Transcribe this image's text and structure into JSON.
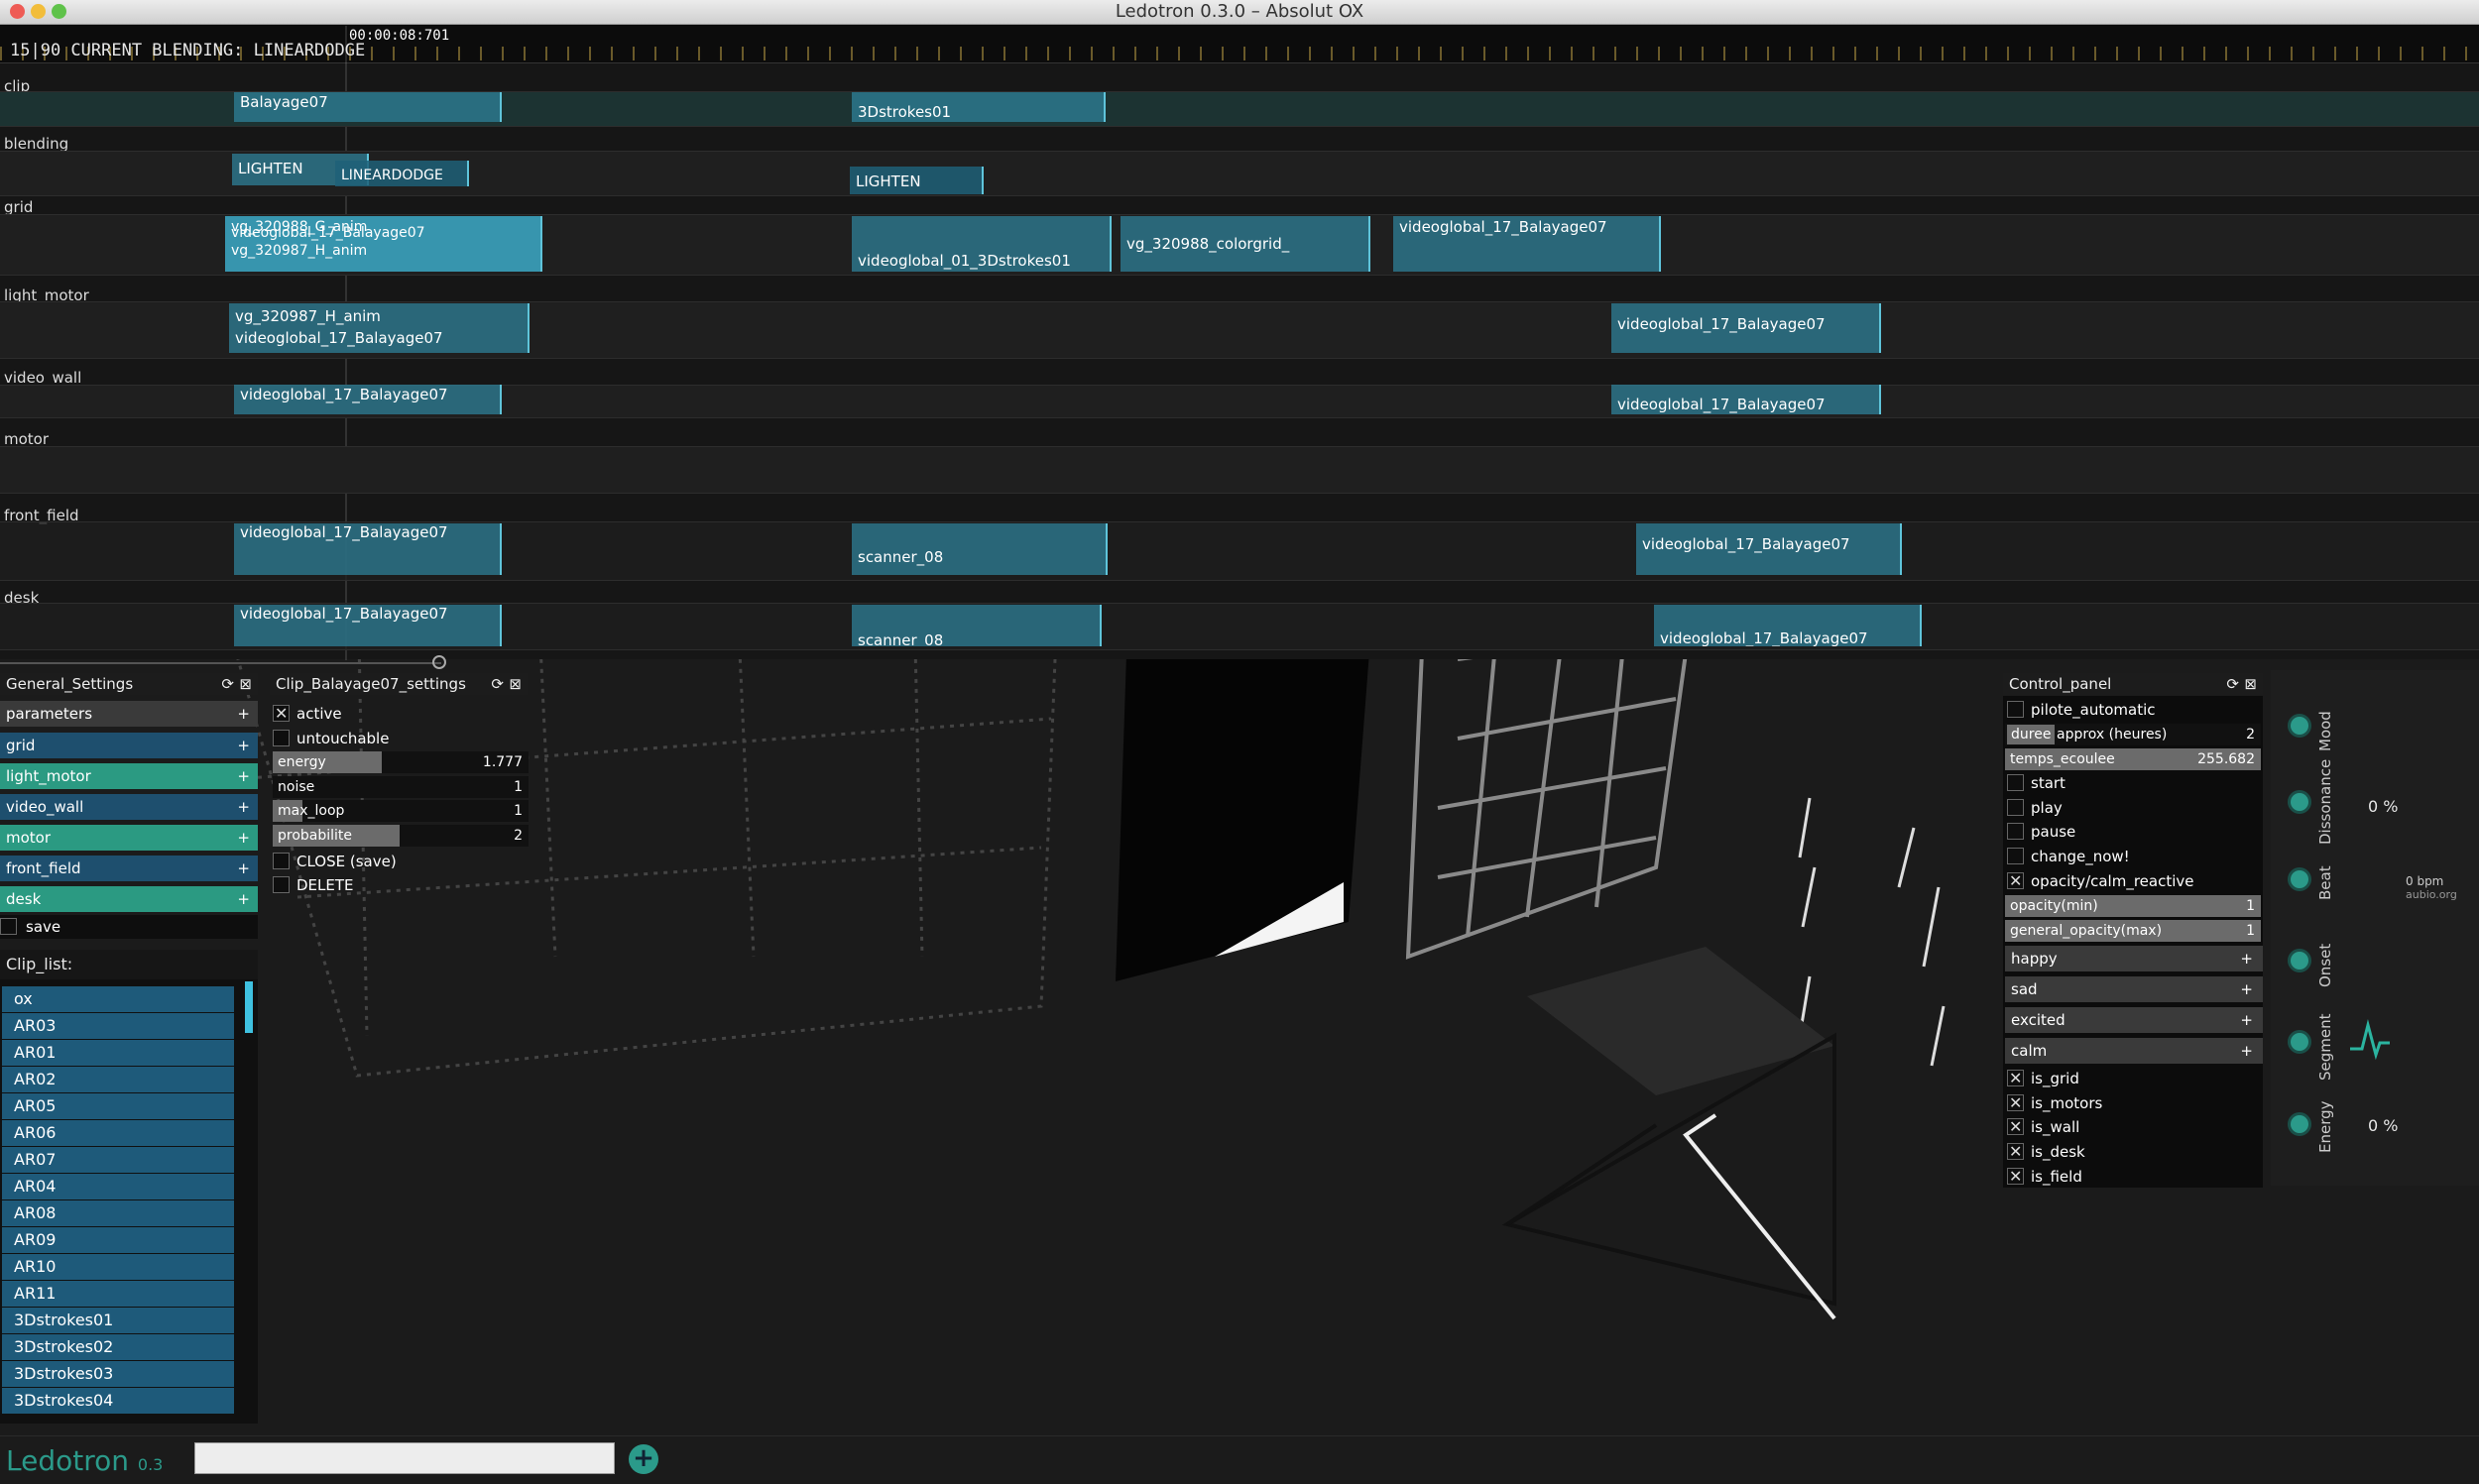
{
  "window": {
    "title": "Ledotron 0.3.0 – Absolut OX"
  },
  "timeline": {
    "status": "15|90 CURRENT BLENDING: LINEARDODGE",
    "time": "00:00:08:701",
    "tracks": [
      {
        "name": "clip",
        "clips": [
          {
            "label": "Balayage07"
          },
          {
            "label": "3Dstrokes01"
          }
        ]
      },
      {
        "name": "blending",
        "clips": [
          {
            "label": "LIGHTEN"
          },
          {
            "label": "LINEARDODGE"
          },
          {
            "label": "LIGHTEN"
          }
        ]
      },
      {
        "name": "grid",
        "clips": [
          {
            "label": "vg_320988_G_anim"
          },
          {
            "label": "videoglobal_17_Balayage07"
          },
          {
            "label": "vg_320987_H_anim"
          },
          {
            "label": "videoglobal_01_3Dstrokes01"
          },
          {
            "label": "vg_320988_colorgrid_"
          },
          {
            "label": "videoglobal_17_Balayage07"
          }
        ]
      },
      {
        "name": "light_motor",
        "clips": [
          {
            "label": "vg_320987_H_anim"
          },
          {
            "label": "videoglobal_17_Balayage07"
          },
          {
            "label": "videoglobal_17_Balayage07"
          }
        ]
      },
      {
        "name": "video_wall",
        "clips": [
          {
            "label": "videoglobal_17_Balayage07"
          },
          {
            "label": "videoglobal_17_Balayage07"
          }
        ]
      },
      {
        "name": "motor",
        "clips": []
      },
      {
        "name": "front_field",
        "clips": [
          {
            "label": "videoglobal_17_Balayage07"
          },
          {
            "label": "scanner_08"
          },
          {
            "label": "videoglobal_17_Balayage07"
          }
        ]
      },
      {
        "name": "desk",
        "clips": [
          {
            "label": "videoglobal_17_Balayage07"
          },
          {
            "label": "scanner_08"
          },
          {
            "label": "videoglobal_17_Balayage07"
          }
        ]
      }
    ]
  },
  "general_settings": {
    "title": "General_Settings",
    "items": [
      {
        "label": "parameters",
        "icon": "+",
        "color": "#1e4f6e"
      },
      {
        "label": "grid",
        "icon": "+",
        "color": "#1e4f6e"
      },
      {
        "label": "light_motor",
        "icon": "+",
        "color": "#2b9a82"
      },
      {
        "label": "video_wall",
        "icon": "+",
        "color": "#1e4f6e"
      },
      {
        "label": "motor",
        "icon": "+",
        "color": "#2b9a82"
      },
      {
        "label": "front_field",
        "icon": "+",
        "color": "#1e4f6e"
      },
      {
        "label": "desk",
        "icon": "+",
        "color": "#2b9a82"
      }
    ],
    "save_label": "save"
  },
  "clip_list": {
    "title": "Clip_list:",
    "items": [
      "ox",
      "AR03",
      "AR01",
      "AR02",
      "AR05",
      "AR06",
      "AR07",
      "AR04",
      "AR08",
      "AR09",
      "AR10",
      "AR11",
      "3Dstrokes01",
      "3Dstrokes02",
      "3Dstrokes03",
      "3Dstrokes04"
    ]
  },
  "clip_settings": {
    "title": "Clip_Balayage07_settings",
    "active_label": "active",
    "active": true,
    "untouchable_label": "untouchable",
    "untouchable": false,
    "energy": {
      "label": "energy",
      "value": "1.777",
      "fraction": 0.42
    },
    "noise": {
      "label": "noise",
      "value": "1",
      "fraction": 0.0
    },
    "max_loop": {
      "label": "max_loop",
      "value": "1",
      "fraction": 0.12
    },
    "probabilite": {
      "label": "probabilite",
      "value": "2",
      "fraction": 0.47
    },
    "close_label": "CLOSE (save)",
    "delete_label": "DELETE"
  },
  "control_panel": {
    "title": "Control_panel",
    "pilote_label": "pilote_automatic",
    "duree": {
      "tag": "duree",
      "label": "approx (heures)",
      "value": "2"
    },
    "temps": {
      "label": "temps_ecoulee",
      "value": "255.682"
    },
    "start_label": "start",
    "play_label": "play",
    "pause_label": "pause",
    "change_label": "change_now!",
    "opacity_reactive_label": "opacity/calm_reactive",
    "opacity_min": {
      "label": "opacity(min)",
      "value": "1"
    },
    "general_opacity": {
      "label": "general_opacity(max)",
      "value": "1"
    },
    "moods": [
      {
        "label": "happy",
        "icon": "+"
      },
      {
        "label": "sad",
        "icon": "+"
      },
      {
        "label": "excited",
        "icon": "+"
      },
      {
        "label": "calm",
        "icon": "+"
      }
    ],
    "toggles": [
      {
        "label": "is_grid",
        "on": true
      },
      {
        "label": "is_motors",
        "on": true
      },
      {
        "label": "is_wall",
        "on": true
      },
      {
        "label": "is_desk",
        "on": true
      },
      {
        "label": "is_field",
        "on": true
      }
    ]
  },
  "audio": {
    "labels": [
      "Mood",
      "Dissonance",
      "Beat",
      "Onset",
      "Segment",
      "Energy"
    ],
    "dissonance_value": "0 %",
    "bpm_value": "0 bpm",
    "bpm_source": "aubio.org",
    "energy_value": "0 %"
  },
  "bottom": {
    "logo": "Ledotron",
    "version": "0.3",
    "input_value": ""
  },
  "colors": {
    "accent": "#2b9a82",
    "clip": "#2f849c",
    "list": "#1e5a7a"
  }
}
